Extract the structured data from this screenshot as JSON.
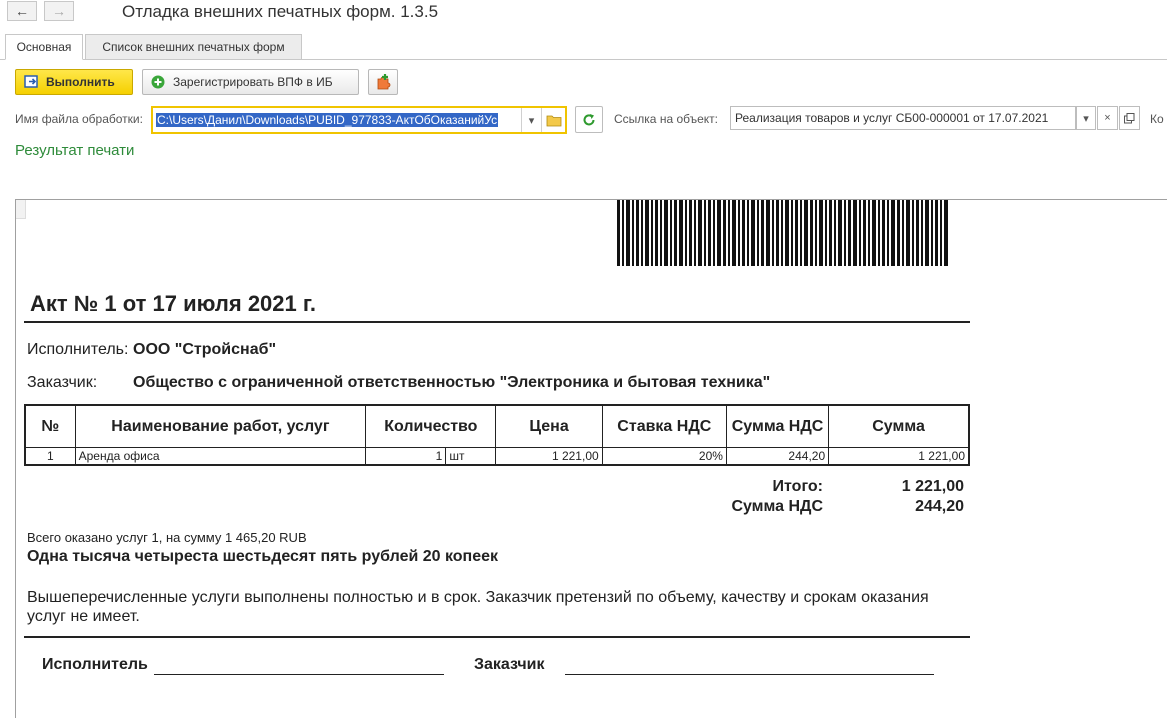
{
  "window": {
    "title": "Отладка внешних печатных форм. 1.3.5"
  },
  "nav": {
    "back_icon": "arrow-left-icon",
    "forward_icon": "arrow-right-icon"
  },
  "tabs": [
    {
      "label": "Основная"
    },
    {
      "label": "Список внешних печатных форм"
    }
  ],
  "toolbar": {
    "run_label": "Выполнить",
    "register_label": "Зарегистрировать ВПФ в ИБ"
  },
  "form": {
    "file_label": "Имя файла обработки:",
    "file_value": "C:\\Users\\Данил\\Downloads\\PUBID_977833-АктОбОказанийУс",
    "link_label": "Ссылка на объект:",
    "link_value": "Реализация товаров и услуг СБ00-000001 от 17.07.2021",
    "cut_label": "Ко"
  },
  "result_label": "Результат печати",
  "document": {
    "title": "Акт № 1 от 17 июля 2021 г.",
    "executor_label": "Исполнитель:",
    "executor_value": "ООО \"Стройснаб\"",
    "customer_label": "Заказчик:",
    "customer_value": "Общество с ограниченной ответственностью \"Электроника и бытовая техника\"",
    "table": {
      "headers": [
        "№",
        "Наименование работ, услуг",
        "Количество",
        "Цена",
        "Ставка НДС",
        "Сумма НДС",
        "Сумма"
      ],
      "rows": [
        {
          "num": "1",
          "name": "Аренда офиса",
          "qty": "1",
          "unit": "шт",
          "price": "1 221,00",
          "vat_rate": "20%",
          "vat_sum": "244,20",
          "sum": "1 221,00"
        }
      ]
    },
    "total_label": "Итого:",
    "total_value": "1 221,00",
    "vat_label": "Сумма НДС",
    "vat_value": "244,20",
    "summary_line": "Всего оказано услуг 1, на сумму 1 465,20 RUB",
    "sum_words": "Одна тысяча четыреста шестьдесят пять рублей 20 копеек",
    "note": "Вышеперечисленные услуги выполнены полностью и в срок. Заказчик претензий по объему, качеству и срокам оказания услуг не имеет.",
    "sign_executor": "Исполнитель",
    "sign_customer": "Заказчик"
  }
}
